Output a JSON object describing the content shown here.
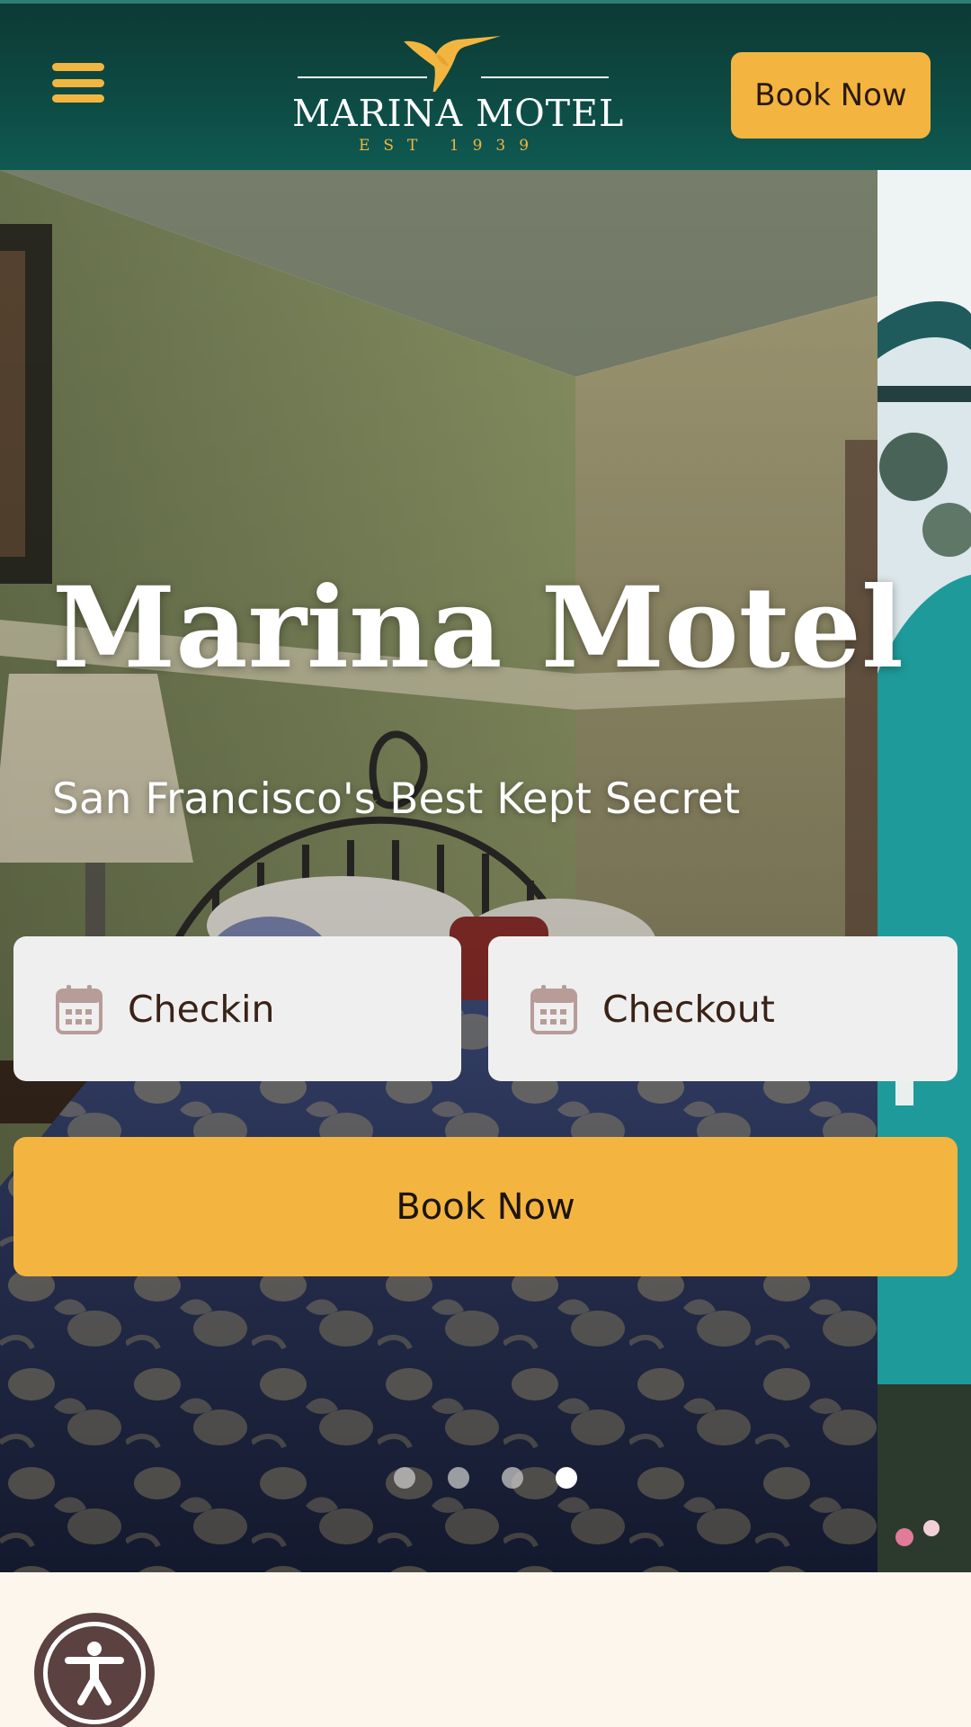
{
  "header": {
    "logo_title": "MARINA MOTEL",
    "logo_est": "EST 1939",
    "book_label": "Book Now"
  },
  "hero": {
    "title": "Marina Motel",
    "subtitle": "San Francisco's Best Kept Secret",
    "checkin_label": "Checkin",
    "checkout_label": "Checkout",
    "book_label": "Book Now",
    "slides_total": 4,
    "active_slide": 4
  },
  "colors": {
    "header_bg": "#0d4a43",
    "accent": "#f3b540",
    "cream": "#fdf6ec",
    "accessibility": "#5b4140"
  },
  "icons": {
    "menu": "hamburger-icon",
    "logo": "hummingbird-icon",
    "date": "calendar-icon",
    "accessibility": "accessibility-icon"
  }
}
